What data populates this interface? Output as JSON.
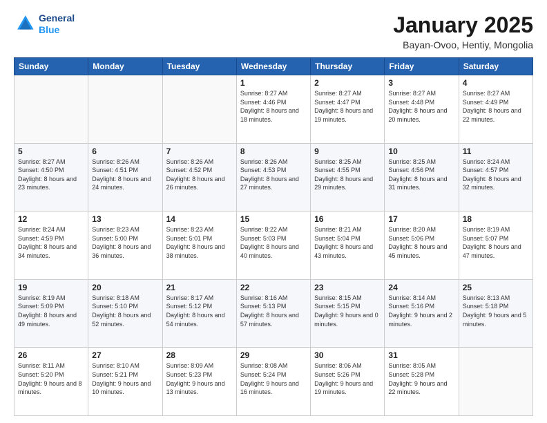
{
  "header": {
    "logo_line1": "General",
    "logo_line2": "Blue",
    "title": "January 2025",
    "location": "Bayan-Ovoo, Hentiy, Mongolia"
  },
  "weekdays": [
    "Sunday",
    "Monday",
    "Tuesday",
    "Wednesday",
    "Thursday",
    "Friday",
    "Saturday"
  ],
  "weeks": [
    [
      {
        "day": "",
        "sunrise": "",
        "sunset": "",
        "daylight": ""
      },
      {
        "day": "",
        "sunrise": "",
        "sunset": "",
        "daylight": ""
      },
      {
        "day": "",
        "sunrise": "",
        "sunset": "",
        "daylight": ""
      },
      {
        "day": "1",
        "sunrise": "Sunrise: 8:27 AM",
        "sunset": "Sunset: 4:46 PM",
        "daylight": "Daylight: 8 hours and 18 minutes."
      },
      {
        "day": "2",
        "sunrise": "Sunrise: 8:27 AM",
        "sunset": "Sunset: 4:47 PM",
        "daylight": "Daylight: 8 hours and 19 minutes."
      },
      {
        "day": "3",
        "sunrise": "Sunrise: 8:27 AM",
        "sunset": "Sunset: 4:48 PM",
        "daylight": "Daylight: 8 hours and 20 minutes."
      },
      {
        "day": "4",
        "sunrise": "Sunrise: 8:27 AM",
        "sunset": "Sunset: 4:49 PM",
        "daylight": "Daylight: 8 hours and 22 minutes."
      }
    ],
    [
      {
        "day": "5",
        "sunrise": "Sunrise: 8:27 AM",
        "sunset": "Sunset: 4:50 PM",
        "daylight": "Daylight: 8 hours and 23 minutes."
      },
      {
        "day": "6",
        "sunrise": "Sunrise: 8:26 AM",
        "sunset": "Sunset: 4:51 PM",
        "daylight": "Daylight: 8 hours and 24 minutes."
      },
      {
        "day": "7",
        "sunrise": "Sunrise: 8:26 AM",
        "sunset": "Sunset: 4:52 PM",
        "daylight": "Daylight: 8 hours and 26 minutes."
      },
      {
        "day": "8",
        "sunrise": "Sunrise: 8:26 AM",
        "sunset": "Sunset: 4:53 PM",
        "daylight": "Daylight: 8 hours and 27 minutes."
      },
      {
        "day": "9",
        "sunrise": "Sunrise: 8:25 AM",
        "sunset": "Sunset: 4:55 PM",
        "daylight": "Daylight: 8 hours and 29 minutes."
      },
      {
        "day": "10",
        "sunrise": "Sunrise: 8:25 AM",
        "sunset": "Sunset: 4:56 PM",
        "daylight": "Daylight: 8 hours and 31 minutes."
      },
      {
        "day": "11",
        "sunrise": "Sunrise: 8:24 AM",
        "sunset": "Sunset: 4:57 PM",
        "daylight": "Daylight: 8 hours and 32 minutes."
      }
    ],
    [
      {
        "day": "12",
        "sunrise": "Sunrise: 8:24 AM",
        "sunset": "Sunset: 4:59 PM",
        "daylight": "Daylight: 8 hours and 34 minutes."
      },
      {
        "day": "13",
        "sunrise": "Sunrise: 8:23 AM",
        "sunset": "Sunset: 5:00 PM",
        "daylight": "Daylight: 8 hours and 36 minutes."
      },
      {
        "day": "14",
        "sunrise": "Sunrise: 8:23 AM",
        "sunset": "Sunset: 5:01 PM",
        "daylight": "Daylight: 8 hours and 38 minutes."
      },
      {
        "day": "15",
        "sunrise": "Sunrise: 8:22 AM",
        "sunset": "Sunset: 5:03 PM",
        "daylight": "Daylight: 8 hours and 40 minutes."
      },
      {
        "day": "16",
        "sunrise": "Sunrise: 8:21 AM",
        "sunset": "Sunset: 5:04 PM",
        "daylight": "Daylight: 8 hours and 43 minutes."
      },
      {
        "day": "17",
        "sunrise": "Sunrise: 8:20 AM",
        "sunset": "Sunset: 5:06 PM",
        "daylight": "Daylight: 8 hours and 45 minutes."
      },
      {
        "day": "18",
        "sunrise": "Sunrise: 8:19 AM",
        "sunset": "Sunset: 5:07 PM",
        "daylight": "Daylight: 8 hours and 47 minutes."
      }
    ],
    [
      {
        "day": "19",
        "sunrise": "Sunrise: 8:19 AM",
        "sunset": "Sunset: 5:09 PM",
        "daylight": "Daylight: 8 hours and 49 minutes."
      },
      {
        "day": "20",
        "sunrise": "Sunrise: 8:18 AM",
        "sunset": "Sunset: 5:10 PM",
        "daylight": "Daylight: 8 hours and 52 minutes."
      },
      {
        "day": "21",
        "sunrise": "Sunrise: 8:17 AM",
        "sunset": "Sunset: 5:12 PM",
        "daylight": "Daylight: 8 hours and 54 minutes."
      },
      {
        "day": "22",
        "sunrise": "Sunrise: 8:16 AM",
        "sunset": "Sunset: 5:13 PM",
        "daylight": "Daylight: 8 hours and 57 minutes."
      },
      {
        "day": "23",
        "sunrise": "Sunrise: 8:15 AM",
        "sunset": "Sunset: 5:15 PM",
        "daylight": "Daylight: 9 hours and 0 minutes."
      },
      {
        "day": "24",
        "sunrise": "Sunrise: 8:14 AM",
        "sunset": "Sunset: 5:16 PM",
        "daylight": "Daylight: 9 hours and 2 minutes."
      },
      {
        "day": "25",
        "sunrise": "Sunrise: 8:13 AM",
        "sunset": "Sunset: 5:18 PM",
        "daylight": "Daylight: 9 hours and 5 minutes."
      }
    ],
    [
      {
        "day": "26",
        "sunrise": "Sunrise: 8:11 AM",
        "sunset": "Sunset: 5:20 PM",
        "daylight": "Daylight: 9 hours and 8 minutes."
      },
      {
        "day": "27",
        "sunrise": "Sunrise: 8:10 AM",
        "sunset": "Sunset: 5:21 PM",
        "daylight": "Daylight: 9 hours and 10 minutes."
      },
      {
        "day": "28",
        "sunrise": "Sunrise: 8:09 AM",
        "sunset": "Sunset: 5:23 PM",
        "daylight": "Daylight: 9 hours and 13 minutes."
      },
      {
        "day": "29",
        "sunrise": "Sunrise: 8:08 AM",
        "sunset": "Sunset: 5:24 PM",
        "daylight": "Daylight: 9 hours and 16 minutes."
      },
      {
        "day": "30",
        "sunrise": "Sunrise: 8:06 AM",
        "sunset": "Sunset: 5:26 PM",
        "daylight": "Daylight: 9 hours and 19 minutes."
      },
      {
        "day": "31",
        "sunrise": "Sunrise: 8:05 AM",
        "sunset": "Sunset: 5:28 PM",
        "daylight": "Daylight: 9 hours and 22 minutes."
      },
      {
        "day": "",
        "sunrise": "",
        "sunset": "",
        "daylight": ""
      }
    ]
  ]
}
